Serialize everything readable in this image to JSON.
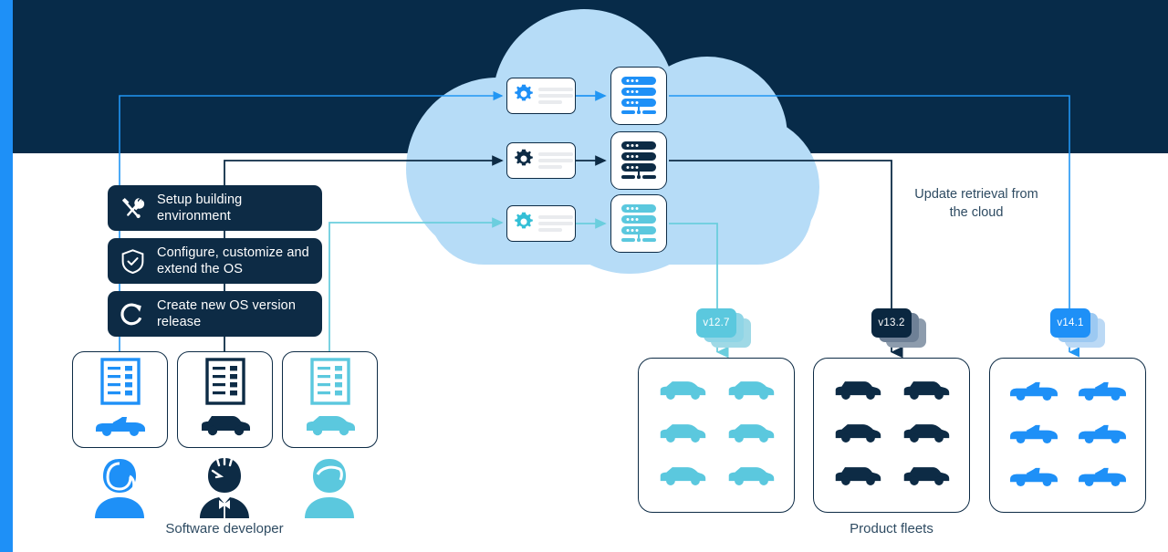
{
  "colors": {
    "navy": "#0D2B45",
    "navy_band": "#072B49",
    "blue": "#1E90F7",
    "blue_bright": "#2196F3",
    "cyan": "#5BC8DE",
    "cloud": "#B6DCF7",
    "text": "#2E4B62",
    "line_gray": "#E9EBEE"
  },
  "background": {
    "left_strip_color": "#1E90F7",
    "header_band_color": "#072B49"
  },
  "process_steps": [
    {
      "icon": "wrench-screwdriver-icon",
      "label": "Setup building\nenvironment"
    },
    {
      "icon": "shield-check-icon",
      "label": "Configure, customize and\nextend the OS"
    },
    {
      "icon": "refresh-icon",
      "label": "Create new OS version\nrelease"
    }
  ],
  "devices": [
    {
      "icon": "checklist-document-icon",
      "vehicle": "convertible-car-icon",
      "color": "#1E90F7"
    },
    {
      "icon": "checklist-document-icon",
      "vehicle": "sedan-car-icon",
      "color": "#0D2B45"
    },
    {
      "icon": "checklist-document-icon",
      "vehicle": "hatchback-car-icon",
      "color": "#5BC8DE"
    }
  ],
  "developers": [
    {
      "icon": "avatar-female-icon",
      "color": "#1E90F7"
    },
    {
      "icon": "avatar-male-bowtie-icon",
      "color": "#0D2B45"
    },
    {
      "icon": "avatar-person-icon",
      "color": "#5BC8DE"
    }
  ],
  "developer_caption": "Software developer",
  "cloud": {
    "icon": "cloud-shape",
    "pipelines": [
      {
        "gear_icon": "gear-icon",
        "server_icon": "server-stack-icon",
        "color": "#1E90F7"
      },
      {
        "gear_icon": "gear-icon",
        "server_icon": "server-stack-icon",
        "color": "#0D2B45"
      },
      {
        "gear_icon": "gear-icon",
        "server_icon": "server-stack-icon",
        "color": "#5BC8DE"
      }
    ]
  },
  "update_note": "Update retrieval from\nthe cloud",
  "versions": [
    {
      "label": "v12.7",
      "color": "#5BC8DE",
      "shadow": "#9FD9E6"
    },
    {
      "label": "v13.2",
      "color": "#0D2B45",
      "shadow": "#6E8096"
    },
    {
      "label": "v14.1",
      "color": "#1E90F7",
      "shadow": "#9CC9F2"
    }
  ],
  "fleets": [
    {
      "vehicle": "hatchback-car-icon",
      "color": "#5BC8DE",
      "count": 6
    },
    {
      "vehicle": "sedan-car-icon",
      "color": "#0D2B45",
      "count": 6
    },
    {
      "vehicle": "convertible-car-icon",
      "color": "#1E90F7",
      "count": 6
    }
  ],
  "fleets_caption": "Product fleets"
}
